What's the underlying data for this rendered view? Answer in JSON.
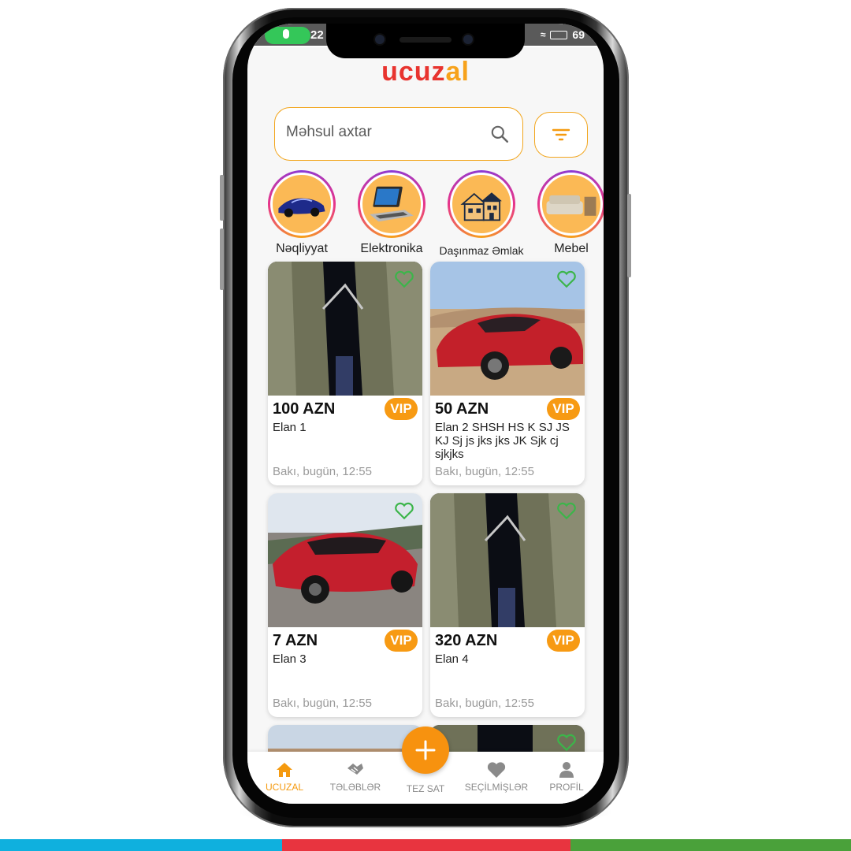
{
  "app": {
    "logo_part1": "ucuz",
    "logo_part2": "al",
    "status_time": "22",
    "status_battery": "69"
  },
  "search": {
    "placeholder": "Məhsul axtar"
  },
  "categories": [
    {
      "label": "Nəqliyyat",
      "icon": "car-icon"
    },
    {
      "label": "Elektronika",
      "icon": "laptop-icon"
    },
    {
      "label": "Daşınmaz Əmlak",
      "icon": "house-icon"
    },
    {
      "label": "Mebel",
      "icon": "sofa-icon"
    }
  ],
  "listings": [
    {
      "price": "100 AZN",
      "badge": "VIP",
      "title": "Elan 1",
      "meta": "Bakı, bugün, 12:55",
      "image": "towers"
    },
    {
      "price": "50 AZN",
      "badge": "VIP",
      "title": "Elan 2 SHSH HS K SJ JS KJ Sj js jks jks JK Sjk cj sjkjks",
      "meta": "Bakı, bugün, 12:55",
      "image": "red-car"
    },
    {
      "price": "7 AZN",
      "badge": "VIP",
      "title": "Elan 3",
      "meta": "Bakı, bugün, 12:55",
      "image": "red-car-rear"
    },
    {
      "price": "320 AZN",
      "badge": "VIP",
      "title": "Elan 4",
      "meta": "Bakı, bugün, 12:55",
      "image": "towers"
    }
  ],
  "nav": {
    "home": "UCUZAL",
    "requests": "TƏLƏBLƏR",
    "sell": "TEZ SAT",
    "favorites": "SEÇİLMİŞLƏR",
    "profile": "PROFİL"
  },
  "colors": {
    "accent": "#f7920f",
    "logo_red": "#e8342f",
    "logo_orange": "#f7a21b",
    "heart": "#3cb54a",
    "bar_blue": "#0fb0de",
    "bar_red": "#e8343f",
    "bar_green": "#4aa13a"
  }
}
